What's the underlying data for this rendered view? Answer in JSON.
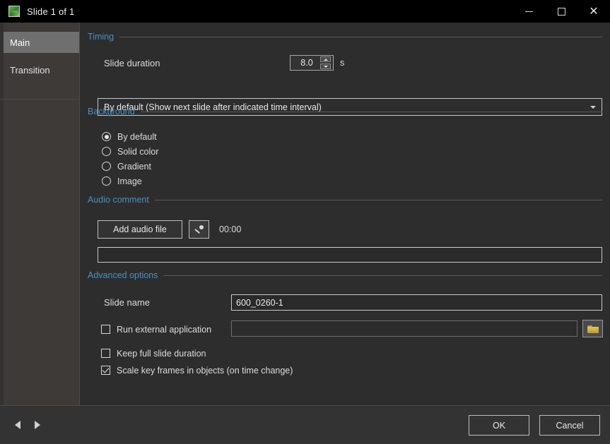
{
  "window": {
    "title": "Slide 1 of 1",
    "icon": "slide-app-icon",
    "controls": {
      "minimize": "─",
      "maximize": "□",
      "close": "✕"
    }
  },
  "sidebar": {
    "items": [
      {
        "label": "Main",
        "selected": true
      },
      {
        "label": "Transition",
        "selected": false
      }
    ]
  },
  "sections": {
    "timing": {
      "title": "Timing",
      "duration_label": "Slide duration",
      "duration_value": "8.0",
      "duration_unit": "s",
      "mode_selected": "By default (Show next slide after indicated time interval)"
    },
    "background": {
      "title": "Background",
      "options": [
        {
          "label": "By default",
          "selected": true
        },
        {
          "label": "Solid color",
          "selected": false
        },
        {
          "label": "Gradient",
          "selected": false
        },
        {
          "label": "Image",
          "selected": false
        }
      ]
    },
    "audio": {
      "title": "Audio comment",
      "add_button": "Add audio file",
      "record_icon": "microphone-icon",
      "timer": "00:00",
      "path_value": ""
    },
    "advanced": {
      "title": "Advanced options",
      "slide_name_label": "Slide name",
      "slide_name_value": "600_0260-1",
      "run_external_label": "Run external application",
      "run_external_checked": false,
      "run_external_value": "",
      "browse_icon": "folder-icon",
      "keep_duration_label": "Keep full slide duration",
      "keep_duration_checked": false,
      "scale_keyframes_label": "Scale key frames in objects (on time change)",
      "scale_keyframes_checked": true
    }
  },
  "footer": {
    "prev_icon": "previous-arrow-icon",
    "next_icon": "next-arrow-icon",
    "ok_label": "OK",
    "cancel_label": "Cancel"
  },
  "colors": {
    "section_header": "#4a90c2",
    "titlebar": "#000000",
    "panel": "#2d2d2d",
    "sidebar": "#3d3a38",
    "selected_item": "#6f6f6f"
  }
}
